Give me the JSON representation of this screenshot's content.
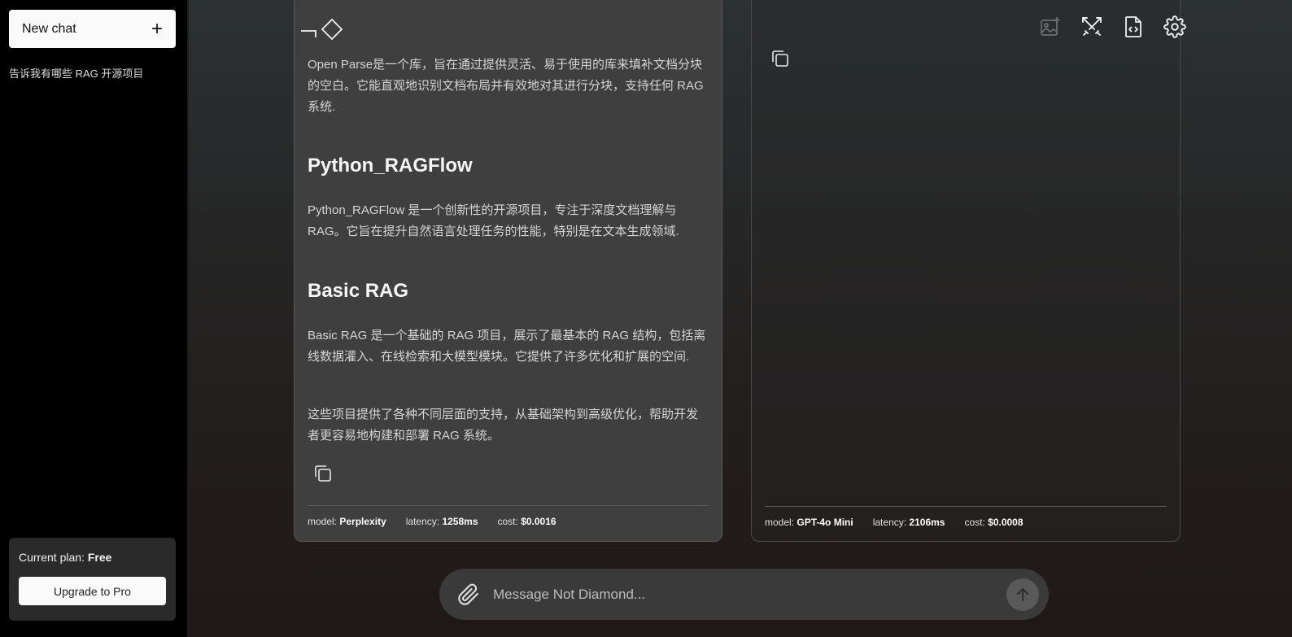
{
  "sidebar": {
    "new_chat_label": "New chat",
    "history": [
      "告诉我有哪些 RAG 开源项目"
    ],
    "plan_label": "Current plan:",
    "plan_value": "Free",
    "upgrade_label": "Upgrade to Pro"
  },
  "topbar": {
    "icons": [
      "image-add-icon",
      "crossed-swords-icon",
      "code-file-icon",
      "gear-icon"
    ]
  },
  "left_panel": {
    "intro": "Open Parse是一个库，旨在通过提供灵活、易于使用的库来填补文档分块的空白。它能直观地识别文档布局并有效地对其进行分块，支持任何 RAG 系统.",
    "section1_title": "Python_RAGFlow",
    "section1_text": "Python_RAGFlow 是一个创新性的开源项目，专注于深度文档理解与 RAG。它旨在提升自然语言处理任务的性能，特别是在文本生成领域.",
    "section2_title": "Basic RAG",
    "section2_text": "Basic RAG 是一个基础的 RAG 项目，展示了最基本的 RAG 结构，包括离线数据灌入、在线检索和大模型模块。它提供了许多优化和扩展的空间.",
    "summary": "这些项目提供了各种不同层面的支持，从基础架构到高级优化，帮助开发者更容易地构建和部署 RAG 系统。",
    "meta": {
      "model_label": "model:",
      "model_value": "Perplexity",
      "latency_label": "latency:",
      "latency_value": "1258ms",
      "cost_label": "cost:",
      "cost_value": "$0.0016"
    }
  },
  "right_panel": {
    "meta": {
      "model_label": "model:",
      "model_value": "GPT-4o Mini",
      "latency_label": "latency:",
      "latency_value": "2106ms",
      "cost_label": "cost:",
      "cost_value": "$0.0008"
    }
  },
  "composer": {
    "placeholder": "Message Not Diamond..."
  },
  "colors": {
    "sidebar_bg": "#000000",
    "panel_bg": "#3f3f3f",
    "button_bg": "#fafafa"
  }
}
